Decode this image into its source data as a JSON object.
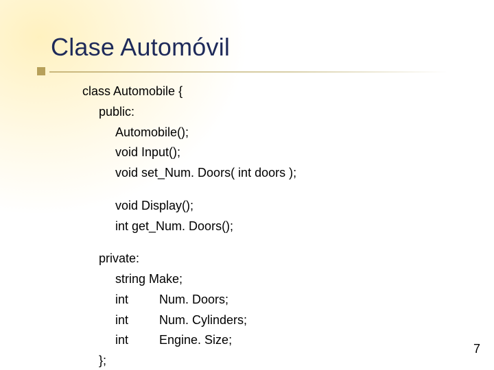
{
  "title": "Clase Automóvil",
  "code": {
    "l0": "class Automobile {",
    "l1": "public:",
    "l2": "Automobile();",
    "l3": "void Input();",
    "l4": "void set_Num. Doors( int doors );",
    "l5": "void Display();",
    "l6": "int get_Num. Doors();",
    "l7": "private:",
    "l8": "string Make;",
    "l9a": "int",
    "l9b": "Num. Doors;",
    "l10a": "int",
    "l10b": "Num. Cylinders;",
    "l11a": "int",
    "l11b": "Engine. Size;",
    "l12": "};"
  },
  "page_number": "7"
}
